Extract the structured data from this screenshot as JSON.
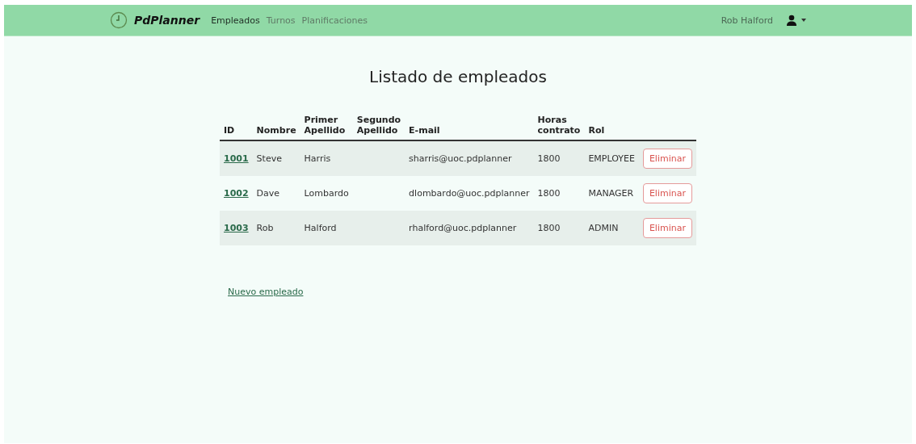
{
  "navbar": {
    "brand": "PdPlanner",
    "links": [
      {
        "label": "Empleados",
        "selected": true
      },
      {
        "label": "Turnos",
        "selected": false
      },
      {
        "label": "Planificaciones",
        "selected": false
      }
    ],
    "user": "Rob Halford"
  },
  "title": "Listado de empleados",
  "table": {
    "columns": [
      "ID",
      "Nombre",
      "Primer Apellido",
      "Segundo Apellido",
      "E-mail",
      "Horas contrato",
      "Rol"
    ],
    "rows": [
      {
        "id": "1001",
        "nombre": "Steve",
        "primer_apellido": "Harris",
        "email": "sharris@uoc.pdplanner",
        "horas": "1800",
        "rol": "EMPLOYEE",
        "action": "Eliminar"
      },
      {
        "id": "1002",
        "nombre": "Dave",
        "primer_apellido": "Lombardo",
        "email": "dlombardo@uoc.pdplanner",
        "horas": "1800",
        "rol": "MANAGER",
        "action": "Eliminar"
      },
      {
        "id": "1003",
        "nombre": "Rob",
        "primer_apellido": "Halford",
        "email": "rhalford@uoc.pdplanner",
        "horas": "1800",
        "rol": "ADMIN",
        "action": "Eliminar"
      }
    ]
  },
  "new_link": "Nuevo empleado"
}
